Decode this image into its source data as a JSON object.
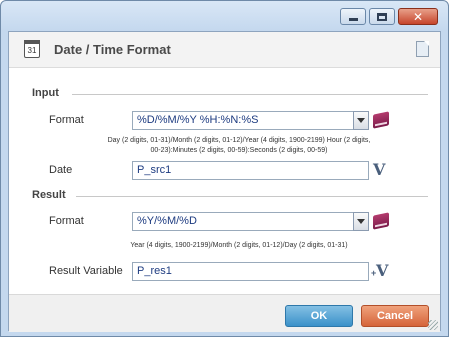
{
  "window": {
    "controls": [
      "minimize",
      "maximize",
      "close"
    ]
  },
  "dialog": {
    "title": "Date / Time Format",
    "icons": {
      "calendar": "calendar-icon",
      "calendar_day": "31",
      "document": "document-icon"
    }
  },
  "input": {
    "section_label": "Input",
    "format_label": "Format",
    "format_value": "%D/%M/%Y %H:%N:%S",
    "format_hint_line1": "Day (2 digits, 01-31)/Month (2 digits, 01-12)/Year (4 digits, 1900-2199) Hour (2 digits,",
    "format_hint_line2": "00-23):Minutes (2 digits, 00-59):Seconds (2 digits, 00-59)",
    "date_label": "Date",
    "date_value": "P_src1"
  },
  "result": {
    "section_label": "Result",
    "format_label": "Format",
    "format_value": "%Y/%M/%D",
    "format_hint": "Year (4 digits, 1900-2199)/Month (2 digits, 01-12)/Day (2 digits, 01-31)",
    "variable_label": "Result Variable",
    "variable_value": "P_res1"
  },
  "buttons": {
    "ok": "OK",
    "cancel": "Cancel"
  }
}
